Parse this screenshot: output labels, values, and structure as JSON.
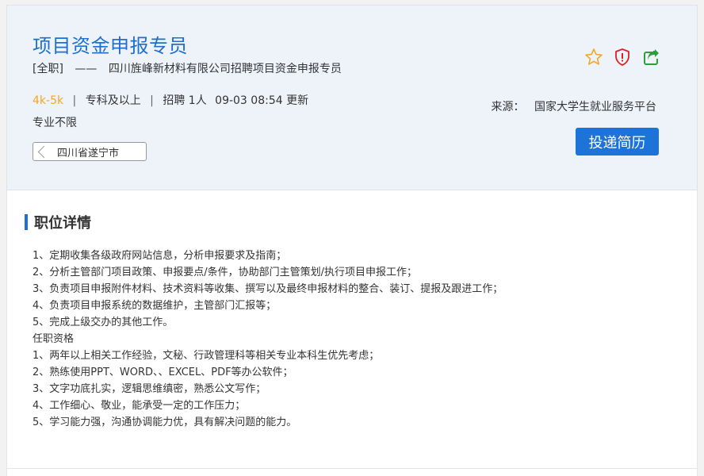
{
  "job": {
    "title": "项目资金申报专员",
    "type": "[全职]",
    "dash": "——",
    "company_line": "四川旌峰新材料有限公司招聘项目资金申报专员",
    "salary": "4k-5k",
    "sep": "|",
    "education": "专科及以上",
    "headcount": "招聘 1人",
    "updated": "09-03 08:54 更新",
    "major": "专业不限",
    "location": "四川省遂宁市"
  },
  "actions": {
    "icons": [
      "star-icon",
      "shield-alert-icon",
      "share-icon"
    ],
    "apply_label": "投递简历"
  },
  "source": {
    "label": "来源：",
    "value": "国家大学生就业服务平台"
  },
  "details": {
    "section_title": "职位详情",
    "lines": [
      "1、定期收集各级政府网站信息，分析申报要求及指南；",
      "2、分析主管部门项目政策、申报要点/条件，协助部门主管策划/执行项目申报工作；",
      "3、负责项目申报附件材料、技术资料等收集、撰写以及最终申报材料的整合、装订、提报及跟进工作；",
      "4、负责项目申报系统的数据维护，主管部门汇报等；",
      "5、完成上级交办的其他工作。",
      "任职资格",
      "1、两年以上相关工作经验，文秘、行政管理科等相关专业本科生优先考虑；",
      "2、熟练使用PPT、WORD、、EXCEL、PDF等办公软件；",
      "3、文字功底扎实，逻辑思维缜密，熟悉公文写作；",
      "4、工作细心、敬业，能承受一定的工作压力；",
      "5、学习能力强，沟通协调能力优，具有解决问题的能力。"
    ]
  },
  "colors": {
    "accent": "#1d6fd1",
    "salary": "#f5a623",
    "star": "#f5a623",
    "alert": "#e02020",
    "share": "#2e9d3e"
  }
}
